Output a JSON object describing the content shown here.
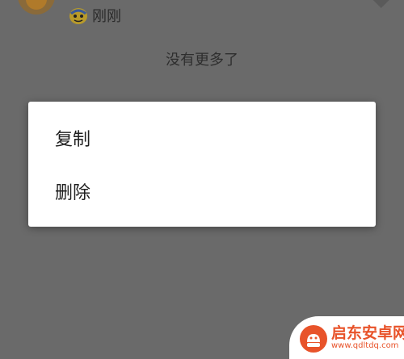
{
  "background": {
    "time_text": "刚刚",
    "no_more_text": "没有更多了"
  },
  "dialog": {
    "items": [
      {
        "label": "复制"
      },
      {
        "label": "删除"
      }
    ]
  },
  "watermark": {
    "title": "启东安卓网",
    "url": "www.qdltdq.com"
  },
  "colors": {
    "overlay": "#6a6a6a",
    "dialog_bg": "#ffffff",
    "watermark_accent": "#e8532a"
  }
}
